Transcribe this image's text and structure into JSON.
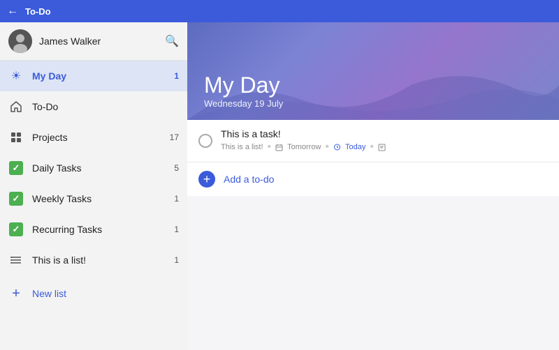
{
  "titleBar": {
    "title": "To-Do",
    "backLabel": "←"
  },
  "sidebar": {
    "user": {
      "name": "James Walker"
    },
    "navItems": [
      {
        "id": "my-day",
        "label": "My Day",
        "badge": "1",
        "active": true,
        "iconType": "sun"
      },
      {
        "id": "todo",
        "label": "To-Do",
        "badge": "",
        "active": false,
        "iconType": "home"
      },
      {
        "id": "projects",
        "label": "Projects",
        "badge": "17",
        "active": false,
        "iconType": "grid"
      },
      {
        "id": "daily-tasks",
        "label": "Daily Tasks",
        "badge": "5",
        "active": false,
        "iconType": "checkbox-green"
      },
      {
        "id": "weekly-tasks",
        "label": "Weekly Tasks",
        "badge": "1",
        "active": false,
        "iconType": "checkbox-green"
      },
      {
        "id": "recurring-tasks",
        "label": "Recurring Tasks",
        "badge": "1",
        "active": false,
        "iconType": "checkbox-green"
      },
      {
        "id": "this-is-a-list",
        "label": "This is a list!",
        "badge": "1",
        "active": false,
        "iconType": "list"
      }
    ],
    "newList": {
      "label": "New list"
    }
  },
  "content": {
    "header": {
      "title": "My Day",
      "subtitle": "Wednesday 19 July"
    },
    "tasks": [
      {
        "id": "task-1",
        "title": "This is a task!",
        "list": "This is a list!",
        "due": "Tomorrow",
        "reminder": "Today",
        "hasNote": true
      }
    ],
    "addTodo": {
      "label": "Add a to-do"
    }
  }
}
